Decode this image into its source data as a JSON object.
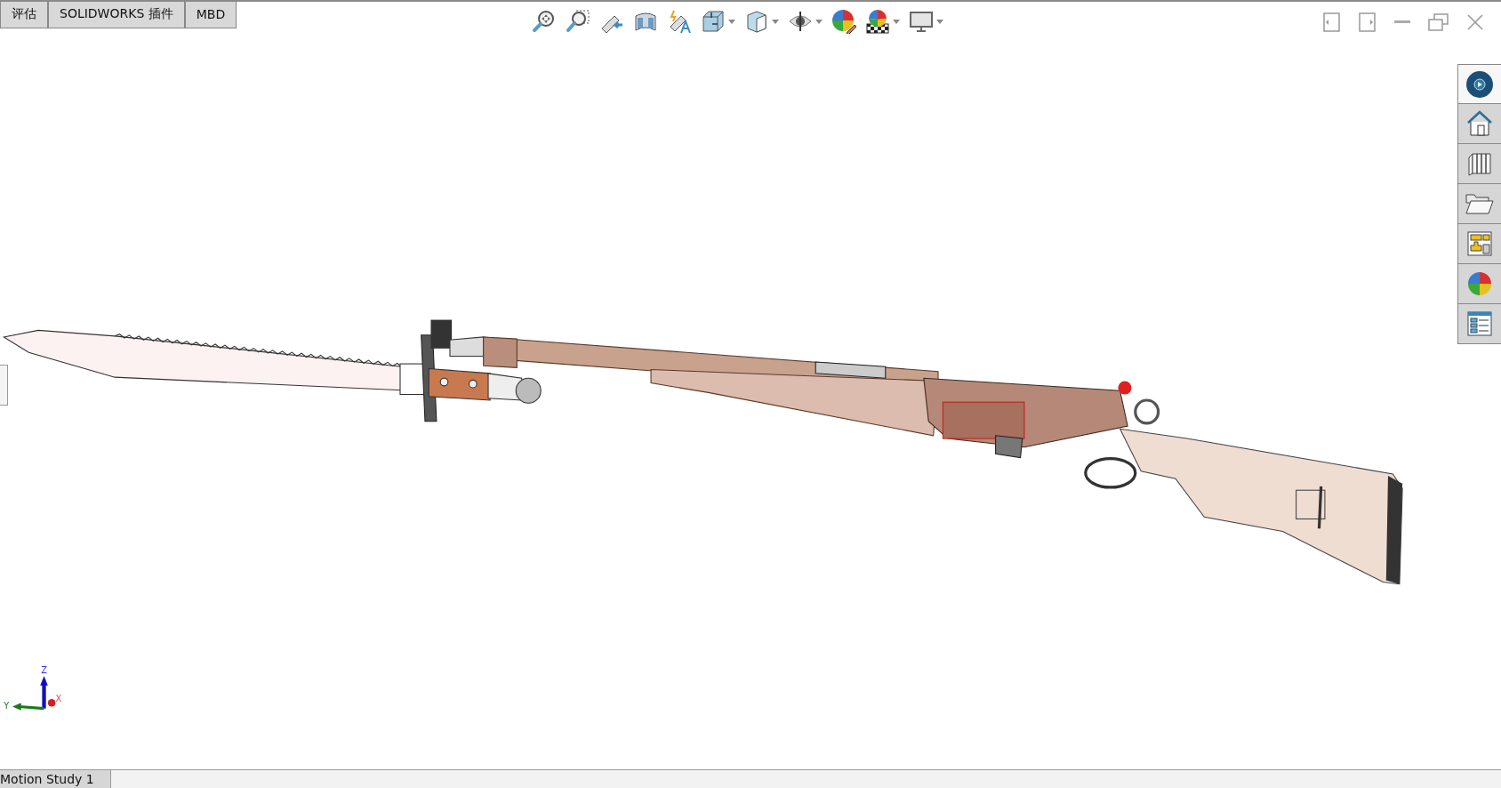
{
  "tabs": [
    {
      "label": "评估"
    },
    {
      "label": "SOLIDWORKS 插件"
    },
    {
      "label": "MBD"
    }
  ],
  "toolbar": [
    {
      "kind": "zoom-fit",
      "dropdown": false
    },
    {
      "kind": "zoom-area",
      "dropdown": false
    },
    {
      "kind": "previous-view",
      "dropdown": false
    },
    {
      "kind": "section-view",
      "dropdown": false
    },
    {
      "kind": "dynamic-annotation",
      "dropdown": false
    },
    {
      "kind": "view-orientation",
      "dropdown": true
    },
    {
      "kind": "display-style",
      "dropdown": true
    },
    {
      "kind": "hide-show",
      "dropdown": true
    },
    {
      "kind": "edit-appearance",
      "dropdown": false
    },
    {
      "kind": "apply-scene",
      "dropdown": true
    },
    {
      "kind": "view-settings",
      "dropdown": true
    }
  ],
  "window_controls": [
    {
      "kind": "tile-left"
    },
    {
      "kind": "tile-right"
    },
    {
      "kind": "minimize"
    },
    {
      "kind": "restore"
    },
    {
      "kind": "close"
    }
  ],
  "task_pane": [
    {
      "kind": "compass",
      "selected": true
    },
    {
      "kind": "home",
      "selected": false
    },
    {
      "kind": "library",
      "selected": false
    },
    {
      "kind": "folder",
      "selected": false
    },
    {
      "kind": "palette",
      "selected": false
    },
    {
      "kind": "appearances",
      "selected": false
    },
    {
      "kind": "properties",
      "selected": false
    }
  ],
  "triad": {
    "z": "Z",
    "y": "Y",
    "x": "X"
  },
  "bottom_tabs": [
    {
      "label": "Motion Study 1"
    }
  ]
}
